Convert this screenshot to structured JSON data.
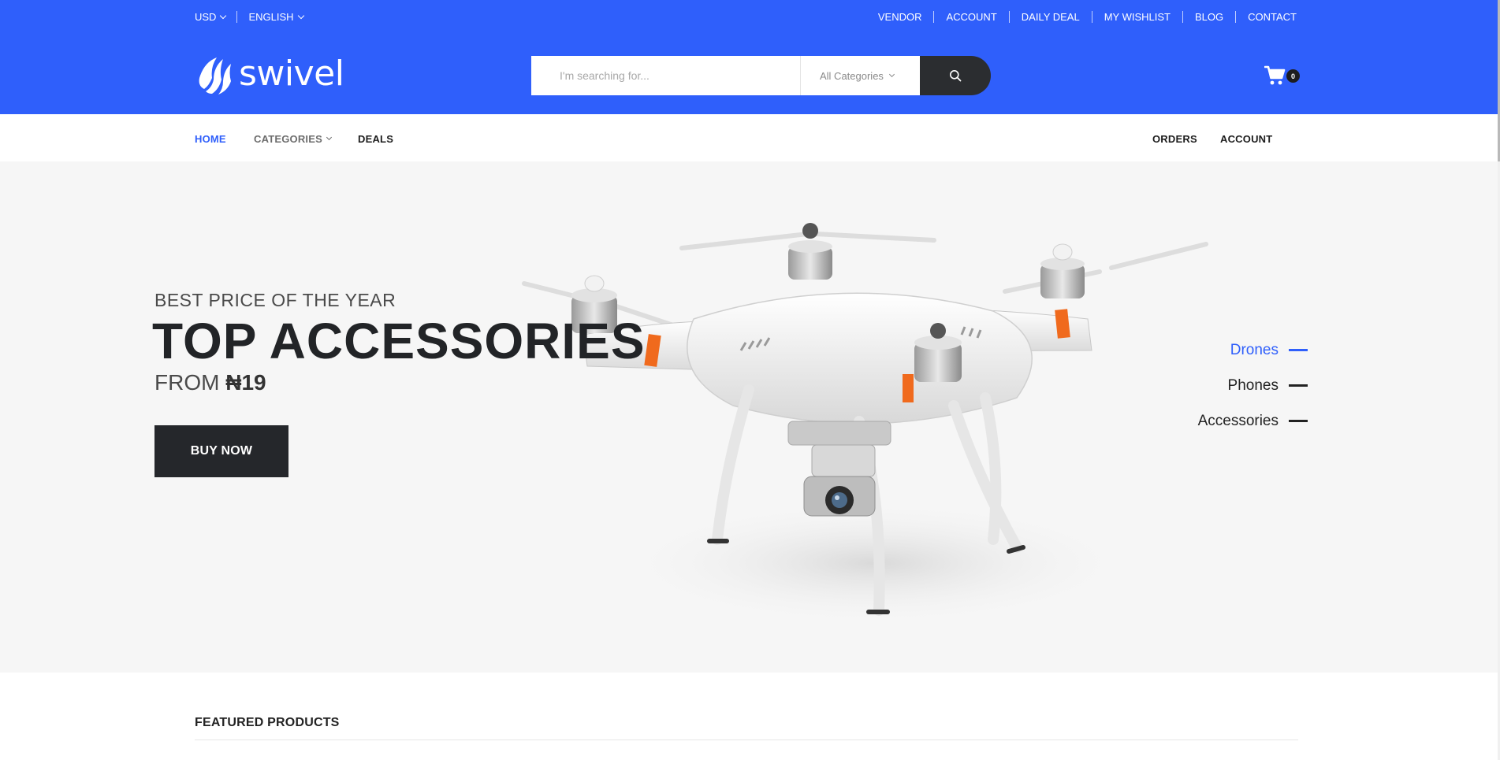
{
  "topbar": {
    "currency": "USD",
    "language": "ENGLISH",
    "links": [
      "VENDOR",
      "ACCOUNT",
      "DAILY DEAL",
      "MY WISHLIST",
      "BLOG",
      "CONTACT"
    ]
  },
  "brand": {
    "name": "swivel"
  },
  "search": {
    "placeholder": "I'm searching for...",
    "category": "All Categories",
    "icon": "search-icon"
  },
  "cart": {
    "icon": "cart-icon",
    "count": "0"
  },
  "nav": {
    "home": "HOME",
    "categories": "CATEGORIES",
    "deals": "DEALS",
    "orders": "ORDERS",
    "account": "ACCOUNT"
  },
  "hero": {
    "kicker": "BEST PRICE OF THE YEAR",
    "title": "TOP ACCESSORIES",
    "from": "FROM ",
    "price": "₦19",
    "button": "BUY NOW",
    "slides": [
      {
        "label": "Drones",
        "active": true
      },
      {
        "label": "Phones",
        "active": false
      },
      {
        "label": "Accessories",
        "active": false
      }
    ]
  },
  "featured": {
    "heading": "FEATURED PRODUCTS"
  },
  "colors": {
    "brand_blue": "#2f5ffb",
    "dark": "#25272b",
    "hero_bg": "#f6f6f6"
  }
}
